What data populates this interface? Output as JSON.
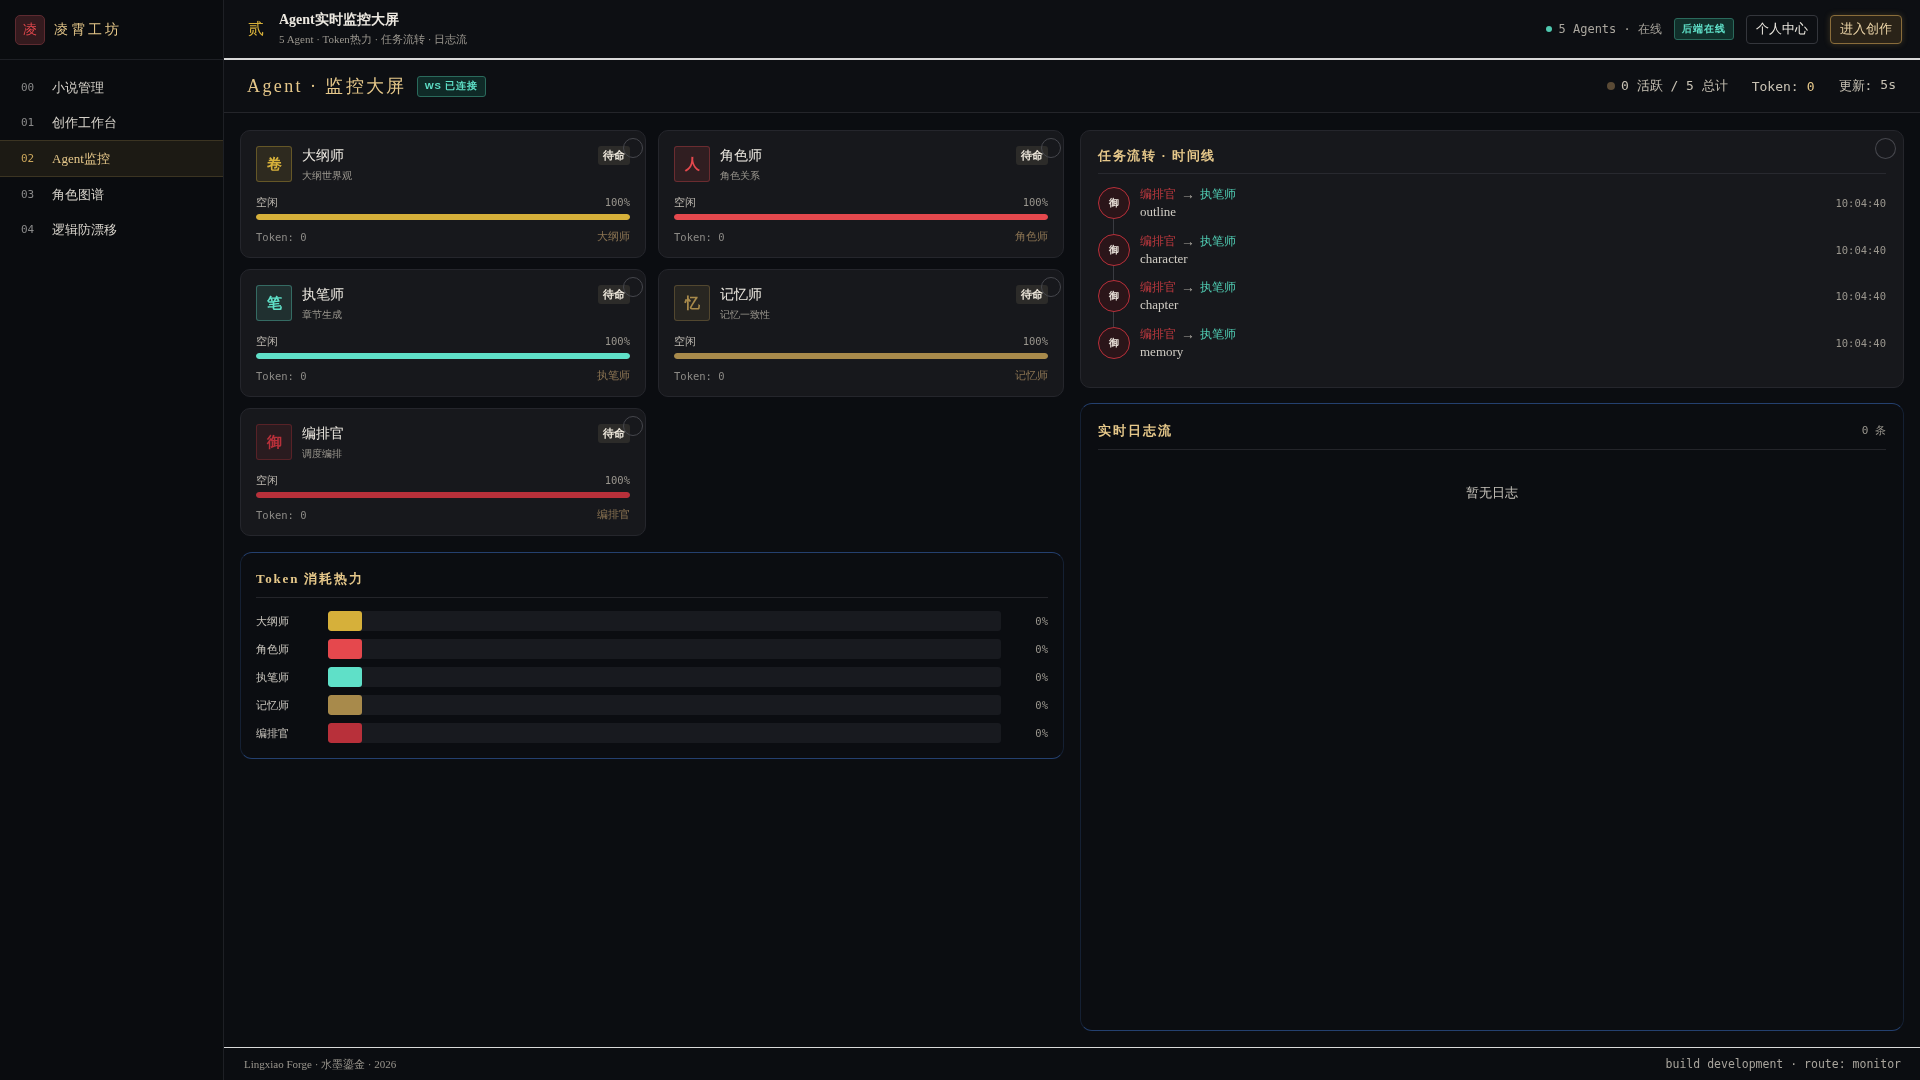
{
  "sidebar": {
    "logo": {
      "glyph": "凌",
      "title": "凌霄工坊"
    },
    "items": [
      {
        "index": "00",
        "label": "小说管理",
        "selected": false
      },
      {
        "index": "01",
        "label": "创作工作台",
        "selected": false
      },
      {
        "index": "02",
        "label": "Agent监控",
        "selected": true
      },
      {
        "index": "03",
        "label": "角色图谱",
        "selected": false
      },
      {
        "index": "04",
        "label": "逻辑防漂移",
        "selected": false
      }
    ]
  },
  "header": {
    "glyph": "贰",
    "title": "Agent实时监控大屏",
    "subtitle": "5 Agent · Token热力 · 任务流转 · 日志流",
    "status": "5 Agents · 在线",
    "online": true,
    "badge": "后端在线",
    "buttons": [
      {
        "label": "个人中心",
        "kind": "outline"
      },
      {
        "label": "进入创作",
        "kind": "primary"
      }
    ]
  },
  "page_bar": {
    "title": "Agent · 监控大屏",
    "badge": "WS 已连接",
    "summary": "0 活跃 / 5 总计",
    "stats": [
      {
        "label": "Token:",
        "value": "0",
        "accent": true
      },
      {
        "label": "更新:",
        "value": "5s",
        "accent": false
      }
    ]
  },
  "agents": [
    {
      "glyph": "卷",
      "name": "大纲师",
      "role": "大纲世界观",
      "status": "待命",
      "state": "空闲",
      "level": 1,
      "percent": "100%",
      "tokens": "Token: 0",
      "tag": "大纲师",
      "color": "#d6b03a"
    },
    {
      "glyph": "人",
      "name": "角色师",
      "role": "角色关系",
      "status": "待命",
      "state": "空闲",
      "level": 1,
      "percent": "100%",
      "tokens": "Token: 0",
      "tag": "角色师",
      "color": "#e5484d"
    },
    {
      "glyph": "笔",
      "name": "执笔师",
      "role": "章节生成",
      "status": "待命",
      "state": "空闲",
      "level": 1,
      "percent": "100%",
      "tokens": "Token: 0",
      "tag": "执笔师",
      "color": "#5fe0c8"
    },
    {
      "glyph": "忆",
      "name": "记忆师",
      "role": "记忆一致性",
      "status": "待命",
      "state": "空闲",
      "level": 1,
      "percent": "100%",
      "tokens": "Token: 0",
      "tag": "记忆师",
      "color": "#a88a4b"
    },
    {
      "glyph": "御",
      "name": "编排官",
      "role": "调度编排",
      "status": "待命",
      "state": "空闲",
      "level": 1,
      "percent": "100%",
      "tokens": "Token: 0",
      "tag": "编排官",
      "color": "#b8303a"
    }
  ],
  "heat": {
    "title": "Token 消耗热力",
    "rows": [
      {
        "label": "大纲师",
        "level": 0.05,
        "percent": "0%",
        "color": "#d6b03a"
      },
      {
        "label": "角色师",
        "level": 0.05,
        "percent": "0%",
        "color": "#e5484d"
      },
      {
        "label": "执笔师",
        "level": 0.05,
        "percent": "0%",
        "color": "#5fe0c8"
      },
      {
        "label": "记忆师",
        "level": 0.05,
        "percent": "0%",
        "color": "#a88a4b"
      },
      {
        "label": "编排官",
        "level": 0.05,
        "percent": "0%",
        "color": "#b8303a"
      }
    ]
  },
  "timeline": {
    "title": "任务流转 · 时间线",
    "items": [
      {
        "glyph": "御",
        "from": "编排官",
        "arrow": "→",
        "to": "执笔师",
        "task": "outline",
        "time": "10:04:40"
      },
      {
        "glyph": "御",
        "from": "编排官",
        "arrow": "→",
        "to": "执笔师",
        "task": "character",
        "time": "10:04:40"
      },
      {
        "glyph": "御",
        "from": "编排官",
        "arrow": "→",
        "to": "执笔师",
        "task": "chapter",
        "time": "10:04:40"
      },
      {
        "glyph": "御",
        "from": "编排官",
        "arrow": "→",
        "to": "执笔师",
        "task": "memory",
        "time": "10:04:40"
      }
    ]
  },
  "logs": {
    "title": "实时日志流",
    "count": "0 条",
    "empty": "暂无日志"
  },
  "footer": {
    "left": "Lingxiao Forge · 水墨鎏金 · 2026",
    "right": "build development · route: monitor"
  }
}
